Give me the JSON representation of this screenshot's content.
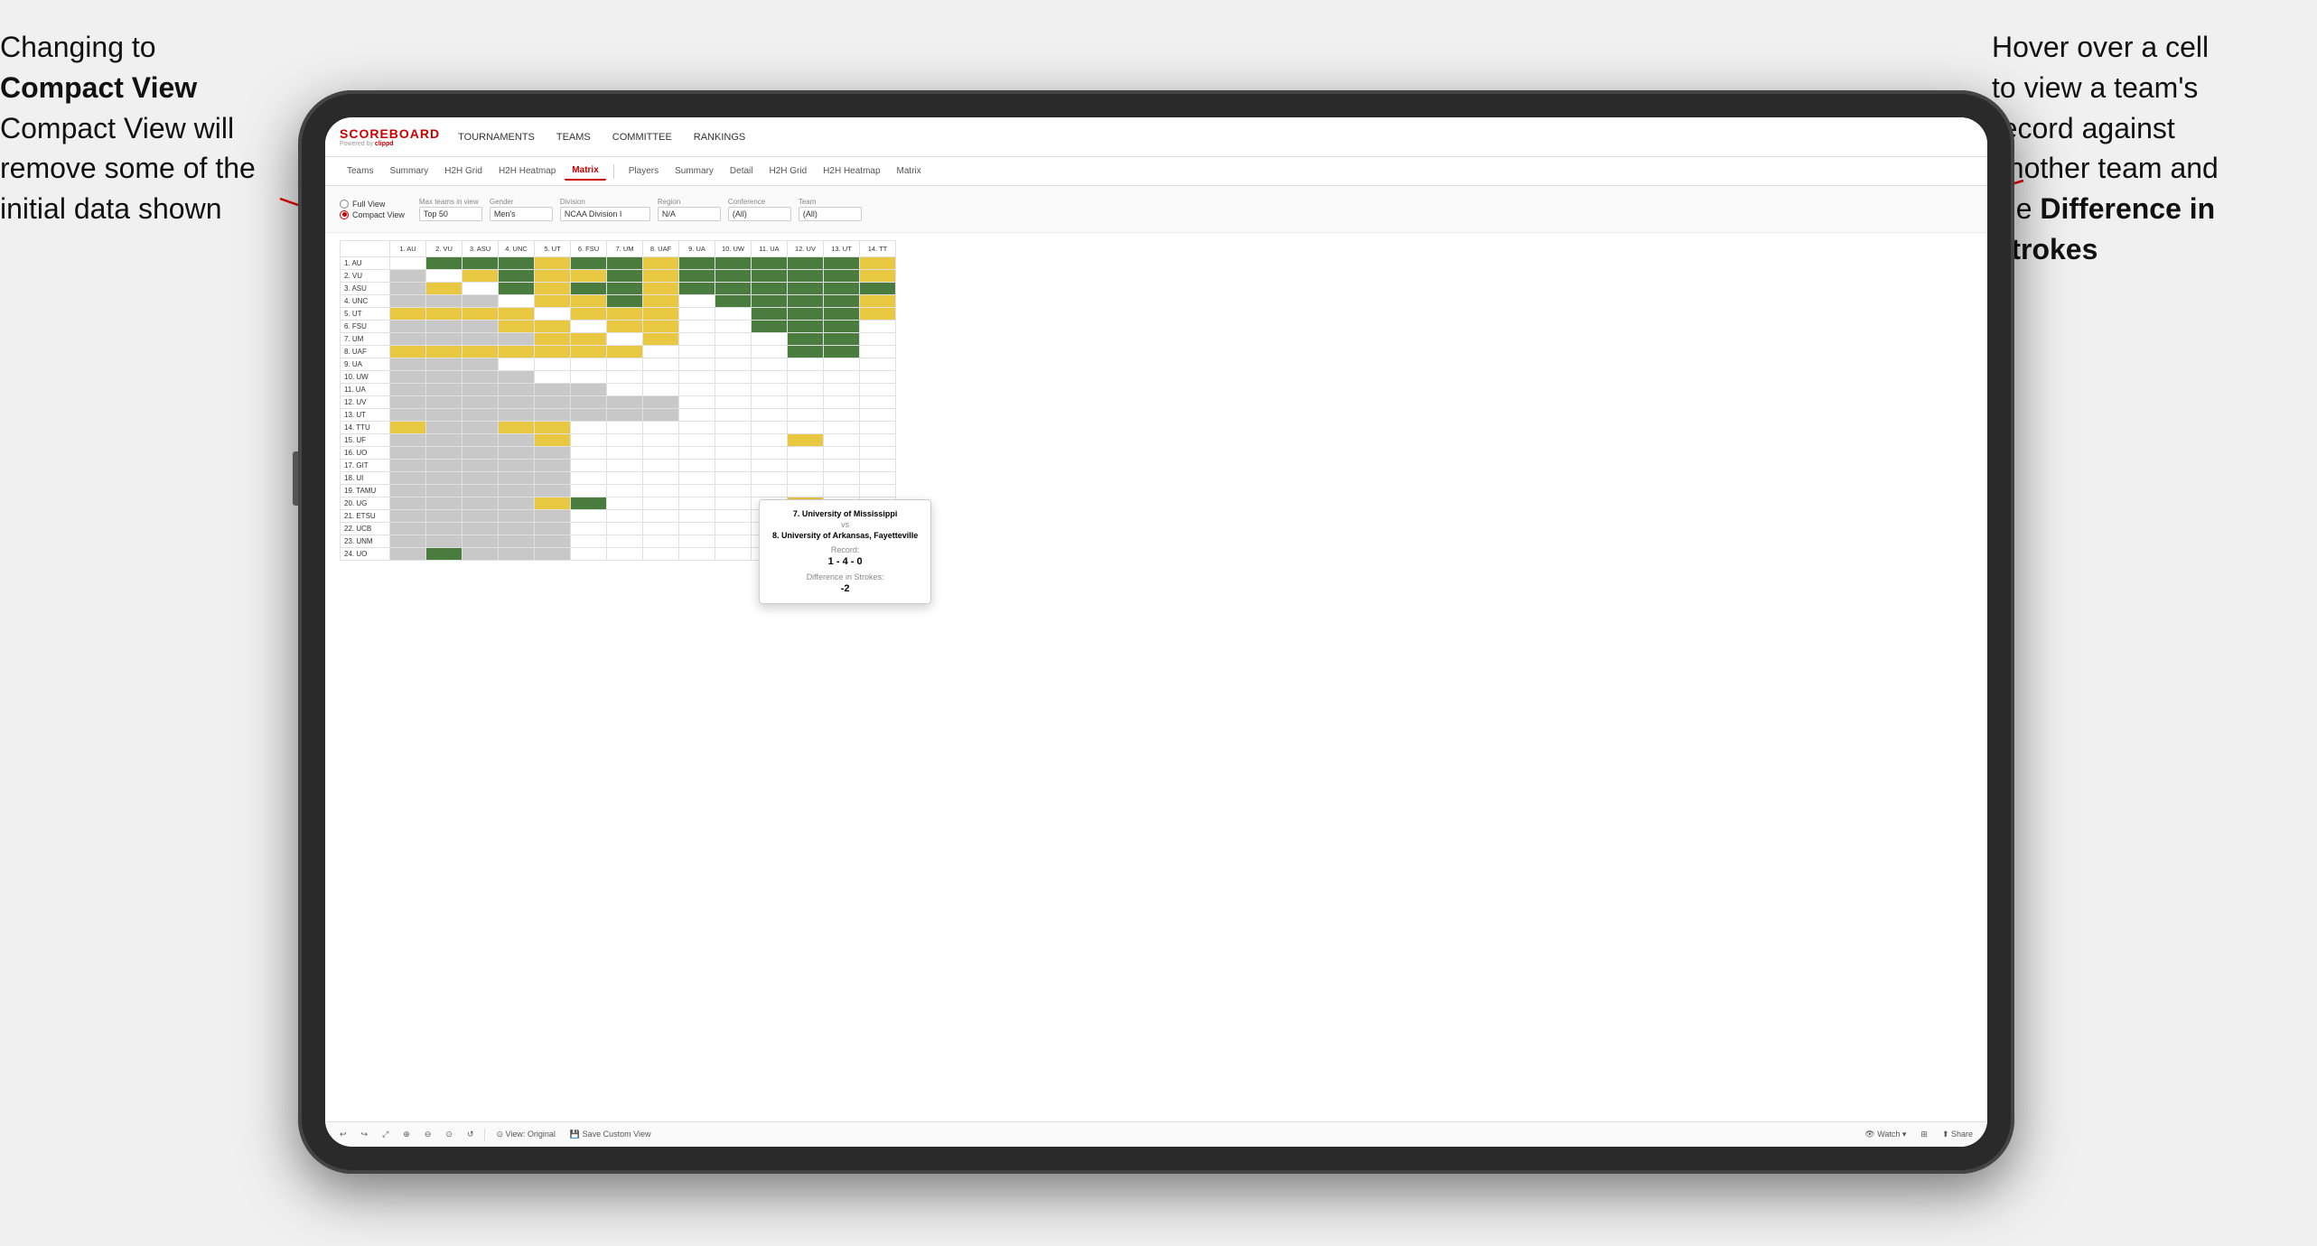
{
  "annotations": {
    "left_text_line1": "Changing to",
    "left_text_line2": "Compact View will",
    "left_text_line3": "remove some of the",
    "left_text_line4": "initial data shown",
    "right_text_line1": "Hover over a cell",
    "right_text_line2": "to view a team's",
    "right_text_line3": "record against",
    "right_text_line4": "another team and",
    "right_text_line5": "the",
    "right_text_bold": "Difference in Strokes"
  },
  "app": {
    "logo": "SCOREBOARD",
    "powered_by": "Powered by clippd",
    "nav": [
      "TOURNAMENTS",
      "TEAMS",
      "COMMITTEE",
      "RANKINGS"
    ],
    "sub_tabs_group1": [
      "Teams",
      "Summary",
      "H2H Grid",
      "H2H Heatmap",
      "Matrix"
    ],
    "sub_tabs_group2": [
      "Players",
      "Summary",
      "Detail",
      "H2H Grid",
      "H2H Heatmap",
      "Matrix"
    ],
    "active_tab": "Matrix",
    "filters": {
      "view_full": "Full View",
      "view_compact": "Compact View",
      "max_teams_label": "Max teams in view",
      "max_teams_value": "Top 50",
      "gender_label": "Gender",
      "gender_value": "Men's",
      "division_label": "Division",
      "division_value": "NCAA Division I",
      "region_label": "Region",
      "region_value": "N/A",
      "conference_label": "Conference",
      "conference_value": "(All)",
      "team_label": "Team",
      "team_value": "(All)"
    },
    "col_headers": [
      "1. AU",
      "2. VU",
      "3. ASU",
      "4. UNC",
      "5. UT",
      "6. FSU",
      "7. UM",
      "8. UAF",
      "9. UA",
      "10. UW",
      "11. UA",
      "12. UV",
      "13. UT",
      "14. TT"
    ],
    "rows": [
      {
        "label": "1. AU",
        "cells": [
          "empty",
          "green",
          "green",
          "green",
          "yellow",
          "green",
          "green",
          "yellow",
          "green",
          "green",
          "green",
          "green",
          "green",
          "yellow"
        ]
      },
      {
        "label": "2. VU",
        "cells": [
          "gray",
          "empty",
          "yellow",
          "green",
          "yellow",
          "yellow",
          "green",
          "yellow",
          "green",
          "green",
          "green",
          "green",
          "green",
          "yellow"
        ]
      },
      {
        "label": "3. ASU",
        "cells": [
          "gray",
          "yellow",
          "empty",
          "green",
          "yellow",
          "green",
          "green",
          "yellow",
          "green",
          "green",
          "green",
          "green",
          "green",
          "green"
        ]
      },
      {
        "label": "4. UNC",
        "cells": [
          "gray",
          "gray",
          "gray",
          "empty",
          "yellow",
          "yellow",
          "green",
          "yellow",
          "white",
          "green",
          "green",
          "green",
          "green",
          "yellow"
        ]
      },
      {
        "label": "5. UT",
        "cells": [
          "yellow",
          "yellow",
          "yellow",
          "yellow",
          "empty",
          "yellow",
          "yellow",
          "yellow",
          "white",
          "white",
          "green",
          "green",
          "green",
          "yellow"
        ]
      },
      {
        "label": "6. FSU",
        "cells": [
          "gray",
          "gray",
          "gray",
          "yellow",
          "yellow",
          "empty",
          "yellow",
          "yellow",
          "white",
          "white",
          "green",
          "green",
          "green",
          "white"
        ]
      },
      {
        "label": "7. UM",
        "cells": [
          "gray",
          "gray",
          "gray",
          "gray",
          "yellow",
          "yellow",
          "empty",
          "yellow",
          "white",
          "white",
          "white",
          "green",
          "green",
          "white"
        ]
      },
      {
        "label": "8. UAF",
        "cells": [
          "yellow",
          "yellow",
          "yellow",
          "yellow",
          "yellow",
          "yellow",
          "yellow",
          "empty",
          "white",
          "white",
          "white",
          "green",
          "green",
          "white"
        ]
      },
      {
        "label": "9. UA",
        "cells": [
          "gray",
          "gray",
          "gray",
          "white",
          "white",
          "white",
          "white",
          "white",
          "empty",
          "white",
          "white",
          "white",
          "white",
          "white"
        ]
      },
      {
        "label": "10. UW",
        "cells": [
          "gray",
          "gray",
          "gray",
          "gray",
          "white",
          "white",
          "white",
          "white",
          "white",
          "empty",
          "white",
          "white",
          "white",
          "white"
        ]
      },
      {
        "label": "11. UA",
        "cells": [
          "gray",
          "gray",
          "gray",
          "gray",
          "gray",
          "gray",
          "white",
          "white",
          "white",
          "white",
          "empty",
          "white",
          "white",
          "white"
        ]
      },
      {
        "label": "12. UV",
        "cells": [
          "gray",
          "gray",
          "gray",
          "gray",
          "gray",
          "gray",
          "gray",
          "gray",
          "white",
          "white",
          "white",
          "empty",
          "white",
          "white"
        ]
      },
      {
        "label": "13. UT",
        "cells": [
          "gray",
          "gray",
          "gray",
          "gray",
          "gray",
          "gray",
          "gray",
          "gray",
          "white",
          "white",
          "white",
          "white",
          "empty",
          "white"
        ]
      },
      {
        "label": "14. TTU",
        "cells": [
          "yellow",
          "gray",
          "gray",
          "yellow",
          "yellow",
          "white",
          "white",
          "white",
          "white",
          "white",
          "white",
          "white",
          "white",
          "empty"
        ]
      },
      {
        "label": "15. UF",
        "cells": [
          "gray",
          "gray",
          "gray",
          "gray",
          "yellow",
          "white",
          "white",
          "white",
          "white",
          "white",
          "white",
          "yellow",
          "white",
          "white"
        ]
      },
      {
        "label": "16. UO",
        "cells": [
          "gray",
          "gray",
          "gray",
          "gray",
          "gray",
          "white",
          "white",
          "white",
          "white",
          "white",
          "white",
          "white",
          "white",
          "white"
        ]
      },
      {
        "label": "17. GIT",
        "cells": [
          "gray",
          "gray",
          "gray",
          "gray",
          "gray",
          "white",
          "white",
          "white",
          "white",
          "white",
          "white",
          "white",
          "white",
          "white"
        ]
      },
      {
        "label": "18. UI",
        "cells": [
          "gray",
          "gray",
          "gray",
          "gray",
          "gray",
          "white",
          "white",
          "white",
          "white",
          "white",
          "white",
          "white",
          "white",
          "white"
        ]
      },
      {
        "label": "19. TAMU",
        "cells": [
          "gray",
          "gray",
          "gray",
          "gray",
          "gray",
          "white",
          "white",
          "white",
          "white",
          "white",
          "white",
          "white",
          "white",
          "white"
        ]
      },
      {
        "label": "20. UG",
        "cells": [
          "gray",
          "gray",
          "gray",
          "gray",
          "yellow",
          "green",
          "white",
          "white",
          "white",
          "white",
          "white",
          "yellow",
          "white",
          "white"
        ]
      },
      {
        "label": "21. ETSU",
        "cells": [
          "gray",
          "gray",
          "gray",
          "gray",
          "gray",
          "white",
          "white",
          "white",
          "white",
          "white",
          "white",
          "white",
          "white",
          "white"
        ]
      },
      {
        "label": "22. UCB",
        "cells": [
          "gray",
          "gray",
          "gray",
          "gray",
          "gray",
          "white",
          "white",
          "white",
          "white",
          "white",
          "white",
          "white",
          "white",
          "white"
        ]
      },
      {
        "label": "23. UNM",
        "cells": [
          "gray",
          "gray",
          "gray",
          "gray",
          "gray",
          "white",
          "white",
          "white",
          "white",
          "white",
          "white",
          "white",
          "white",
          "white"
        ]
      },
      {
        "label": "24. UO",
        "cells": [
          "gray",
          "green",
          "gray",
          "gray",
          "gray",
          "white",
          "white",
          "white",
          "white",
          "white",
          "white",
          "yellow",
          "white",
          "white"
        ]
      }
    ],
    "tooltip": {
      "team1": "7. University of Mississippi",
      "vs": "vs",
      "team2": "8. University of Arkansas, Fayetteville",
      "record_label": "Record:",
      "record_value": "1 - 4 - 0",
      "diff_label": "Difference in Strokes:",
      "diff_value": "-2"
    },
    "toolbar": {
      "undo": "↩",
      "redo": "↪",
      "view_original": "⊙ View: Original",
      "save_custom": "💾 Save Custom View",
      "watch": "👁 Watch",
      "share": "⬆ Share"
    }
  }
}
